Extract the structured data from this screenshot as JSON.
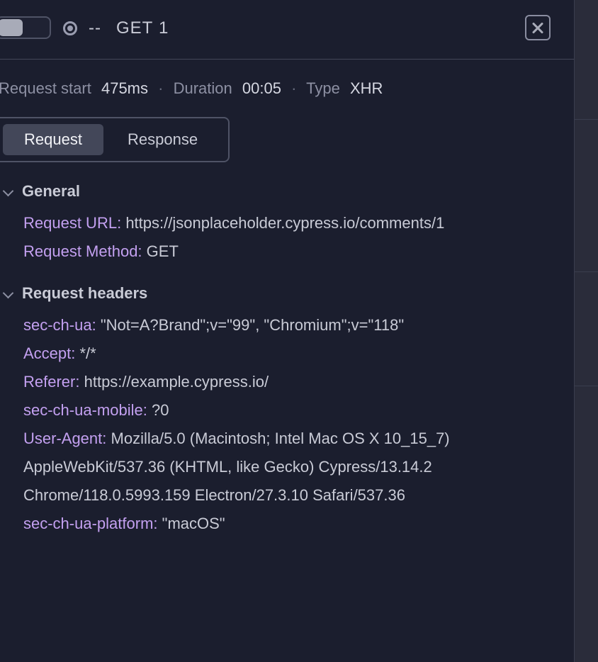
{
  "header": {
    "status_text": "--",
    "method": "GET",
    "index": "1"
  },
  "meta": {
    "request_start_label": "Request start",
    "request_start_value": "475ms",
    "duration_label": "Duration",
    "duration_value": "00:05",
    "type_label": "Type",
    "type_value": "XHR"
  },
  "tabs": [
    {
      "label": "Request",
      "active": true
    },
    {
      "label": "Response",
      "active": false
    }
  ],
  "general": {
    "title": "General",
    "fields": [
      {
        "key": "Request URL:",
        "value": "https://jsonplaceholder.cypress.io/comments/1"
      },
      {
        "key": "Request Method:",
        "value": "GET"
      }
    ]
  },
  "request_headers": {
    "title": "Request headers",
    "fields": [
      {
        "key": "sec-ch-ua:",
        "value": "\"Not=A?Brand\";v=\"99\", \"Chromium\";v=\"118\""
      },
      {
        "key": "Accept:",
        "value": "*/*"
      },
      {
        "key": "Referer:",
        "value": "https://example.cypress.io/"
      },
      {
        "key": "sec-ch-ua-mobile:",
        "value": "?0"
      },
      {
        "key": "User-Agent:",
        "value": "Mozilla/5.0 (Macintosh; Intel Mac OS X 10_15_7)"
      },
      {
        "key": "sec-ch-ua-platform:",
        "value": "\"macOS\""
      }
    ],
    "user_agent_continuation": [
      "AppleWebKit/537.36 (KHTML, like Gecko) Cypress/13.14.2",
      "Chrome/118.0.5993.159 Electron/27.3.10 Safari/537.36"
    ]
  },
  "colors": {
    "background": "#1b1e2e",
    "key_purple": "#c3a0f0",
    "text": "#c9cbd6",
    "muted": "#8d90a3"
  }
}
